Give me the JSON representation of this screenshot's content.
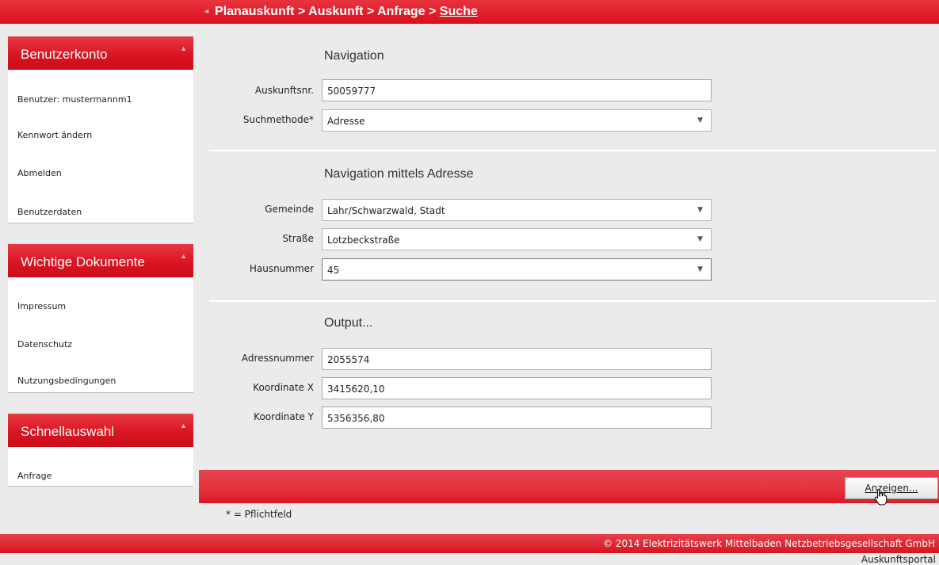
{
  "breadcrumb": {
    "arrow": "◂",
    "path": "Planauskunft > Auskunft > Anfrage > ",
    "current": "Suche"
  },
  "sidebar": {
    "account": {
      "title": "Benutzerkonto",
      "items": [
        "Benutzer: mustermannm1",
        "Kennwort ändern",
        "Abmelden",
        "Benutzerdaten"
      ]
    },
    "documents": {
      "title": "Wichtige Dokumente",
      "items": [
        "Impressum",
        "Datenschutz",
        "Nutzungsbedingungen"
      ]
    },
    "quick": {
      "title": "Schnellauswahl",
      "items": [
        "Anfrage"
      ]
    }
  },
  "sections": {
    "navigation": {
      "title": "Navigation",
      "auskunftsnr_label": "Auskunftsnr.",
      "auskunftsnr_value": "50059777",
      "suchmethode_label": "Suchmethode*",
      "suchmethode_value": "Adresse"
    },
    "address": {
      "title": "Navigation mittels Adresse",
      "gemeinde_label": "Gemeinde",
      "gemeinde_value": "Lahr/Schwarzwald, Stadt",
      "strasse_label": "Straße",
      "strasse_value": "Lotzbeckstraße",
      "hausnummer_label": "Hausnummer",
      "hausnummer_value": "45"
    },
    "output": {
      "title": "Output...",
      "adressnummer_label": "Adressnummer",
      "adressnummer_value": "2055574",
      "x_label": "Koordinate X",
      "x_value": "3415620,10",
      "y_label": "Koordinate Y",
      "y_value": "5356356,80"
    }
  },
  "actions": {
    "show_label": "Anzeigen..."
  },
  "required_note": "* = Pflichtfeld",
  "footer": {
    "copyright": "© 2014 Elektrizitätswerk Mittelbaden Netzbetriebsgesellschaft GmbH",
    "portal": "Auskunftsportal"
  },
  "icons": {
    "dropdown": "▼",
    "collapse": "▲"
  },
  "colors": {
    "accent": "#d90f1c",
    "background": "#ebebeb"
  }
}
